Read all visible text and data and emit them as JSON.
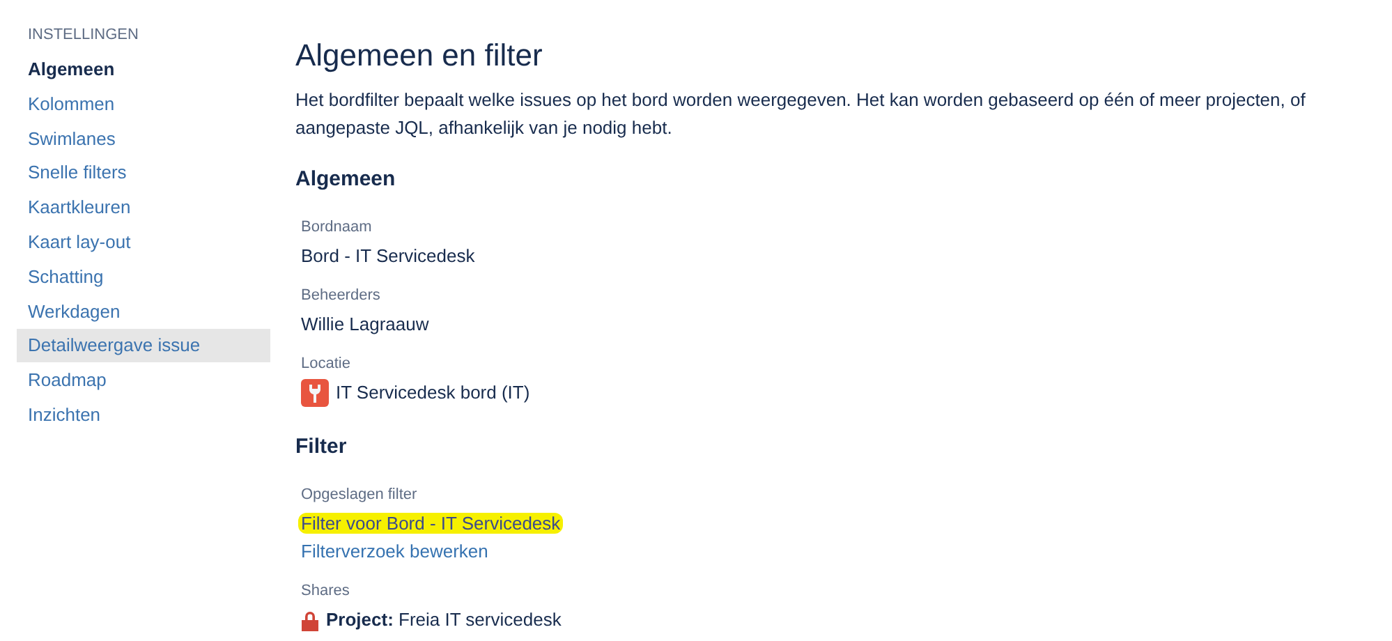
{
  "sidebar": {
    "heading": "INSTELLINGEN",
    "items": [
      {
        "label": "Algemeen",
        "selected": true,
        "hovered": false
      },
      {
        "label": "Kolommen",
        "selected": false,
        "hovered": false
      },
      {
        "label": "Swimlanes",
        "selected": false,
        "hovered": false
      },
      {
        "label": "Snelle filters",
        "selected": false,
        "hovered": false
      },
      {
        "label": "Kaartkleuren",
        "selected": false,
        "hovered": false
      },
      {
        "label": "Kaart lay-out",
        "selected": false,
        "hovered": false
      },
      {
        "label": "Schatting",
        "selected": false,
        "hovered": false
      },
      {
        "label": "Werkdagen",
        "selected": false,
        "hovered": false
      },
      {
        "label": "Detailweergave issue",
        "selected": false,
        "hovered": true
      },
      {
        "label": "Roadmap",
        "selected": false,
        "hovered": false
      },
      {
        "label": "Inzichten",
        "selected": false,
        "hovered": false
      }
    ]
  },
  "page": {
    "title": "Algemeen en filter",
    "description": "Het bordfilter bepaalt welke issues op het bord worden weergegeven. Het kan worden gebaseerd op één of meer projecten, of aangepaste JQL, afhankelijk van je nodig hebt.",
    "sections": [
      {
        "heading": "Algemeen",
        "fields": [
          {
            "label": "Bordnaam",
            "values": [
              {
                "kind": "text",
                "text": "Bord - IT Servicedesk"
              }
            ]
          },
          {
            "label": "Beheerders",
            "values": [
              {
                "kind": "text",
                "text": "Willie Lagraauw"
              }
            ]
          },
          {
            "label": "Locatie",
            "values": [
              {
                "kind": "project",
                "text": "IT Servicedesk bord (IT)"
              }
            ]
          }
        ]
      },
      {
        "heading": "Filter",
        "fields": [
          {
            "label": "Opgeslagen filter",
            "values": [
              {
                "kind": "link",
                "text": "Filter voor Bord - IT Servicedesk",
                "highlighted": true
              },
              {
                "kind": "link",
                "text": "Filterverzoek bewerken",
                "highlighted": false
              }
            ]
          },
          {
            "label": "Shares",
            "values": [
              {
                "kind": "share",
                "text": "**Project:** Freia IT servicedesk"
              }
            ]
          }
        ]
      }
    ]
  }
}
